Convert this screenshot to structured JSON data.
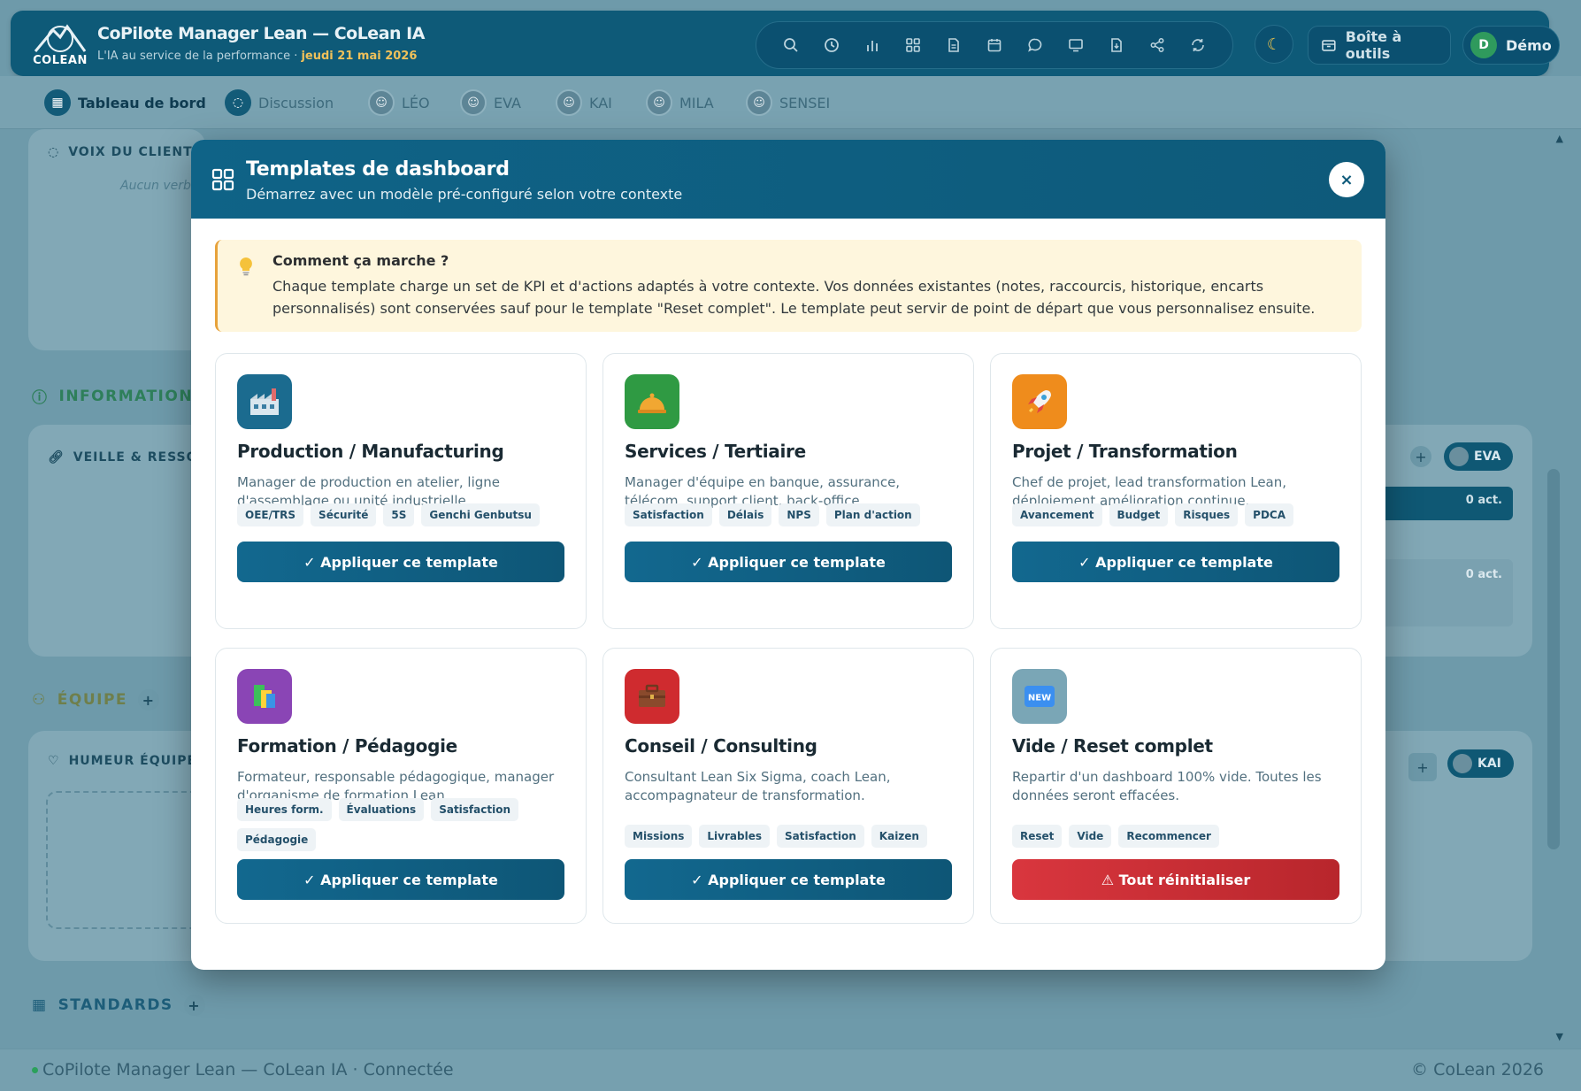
{
  "app": {
    "logo_text": "COLEAN",
    "title": "CoPilote Manager Lean — CoLean IA",
    "subtitle": "L'IA au service de la performance · ",
    "date": "jeudi 21 mai 2026",
    "toolbox_label": "Boîte à outils",
    "user_initial": "D",
    "user_name": "Démo"
  },
  "toolbar_icons": [
    "search-icon",
    "history-icon",
    "bar-chart-icon",
    "grid-icon",
    "document-icon",
    "calendar-icon",
    "chat-icon",
    "monitor-icon",
    "download-icon",
    "share-icon",
    "refresh-icon"
  ],
  "nav": {
    "dashboard": "Tableau de bord",
    "discussion": "Discussion",
    "agents": [
      "LÉO",
      "EVA",
      "KAI",
      "MILA",
      "SENSEI"
    ]
  },
  "background": {
    "voix_client": "VOIX DU CLIENT",
    "voix_empty": "Aucun verb",
    "informations": "INFORMATIONS",
    "veille": "VEILLE & RESSOURC",
    "equipe": "ÉQUIPE",
    "humeur": "HUMEUR ÉQUIPE",
    "standards": "STANDARDS",
    "eva_pill": "EVA",
    "kai_pill": "KAI",
    "act_1": "0 act.",
    "act_2": "0 act.",
    "plus": "+"
  },
  "footer": {
    "left": "CoPilote Manager Lean — CoLean IA · Connectée",
    "right": "© CoLean 2026"
  },
  "modal": {
    "title": "Templates de dashboard",
    "subtitle": "Démarrez avec un modèle pré-configuré selon votre contexte",
    "close": "×",
    "info_title": "Comment ça marche ?",
    "info_text": "Chaque template charge un set de KPI et d'actions adaptés à votre contexte. Vos données existantes (notes, raccourcis, historique, encarts personnalisés) sont conservées sauf pour le template \"Reset complet\". Le template peut servir de point de départ que vous personnalisez ensuite.",
    "cards": [
      {
        "title": "Production / Manufacturing",
        "desc": "Manager de production en atelier, ligne d'assemblage ou unité industrielle.",
        "tags": [
          "OEE/TRS",
          "Sécurité",
          "5S",
          "Genchi Genbutsu"
        ],
        "button": "✓ Appliquer ce template",
        "icon": "factory-icon",
        "color": "#1b6b8f"
      },
      {
        "title": "Services / Tertiaire",
        "desc": "Manager d'équipe en banque, assurance, télécom, support client, back-office.",
        "tags": [
          "Satisfaction",
          "Délais",
          "NPS",
          "Plan d'action"
        ],
        "button": "✓ Appliquer ce template",
        "icon": "service-bell-icon",
        "color": "#2f9a43"
      },
      {
        "title": "Projet / Transformation",
        "desc": "Chef de projet, lead transformation Lean, déploiement amélioration continue.",
        "tags": [
          "Avancement",
          "Budget",
          "Risques",
          "PDCA"
        ],
        "button": "✓ Appliquer ce template",
        "icon": "rocket-icon",
        "color": "#ef8c1c"
      },
      {
        "title": "Formation / Pédagogie",
        "desc": "Formateur, responsable pédagogique, manager d'organisme de formation Lean.",
        "tags": [
          "Heures form.",
          "Évaluations",
          "Satisfaction",
          "Pédagogie"
        ],
        "button": "✓ Appliquer ce template",
        "icon": "books-icon",
        "color": "#8a45b5"
      },
      {
        "title": "Conseil / Consulting",
        "desc": "Consultant Lean Six Sigma, coach Lean, accompagnateur de transformation.",
        "tags": [
          "Missions",
          "Livrables",
          "Satisfaction",
          "Kaizen"
        ],
        "button": "✓ Appliquer ce template",
        "icon": "briefcase-icon",
        "color": "#cf2b2f"
      },
      {
        "title": "Vide / Reset complet",
        "desc": "Repartir d'un dashboard 100% vide. Toutes les données seront effacées.",
        "tags": [
          "Reset",
          "Vide",
          "Recommencer"
        ],
        "button": "⚠ Tout réinitialiser",
        "icon": "new-badge-icon",
        "color": "#7aa6b6",
        "danger": true
      }
    ]
  }
}
